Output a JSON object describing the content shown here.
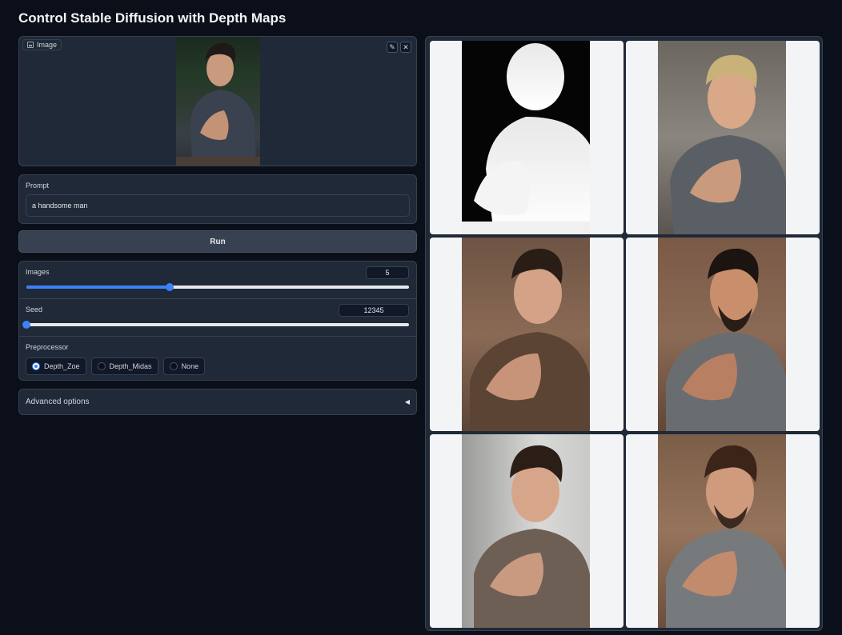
{
  "app": {
    "title": "Control Stable Diffusion with Depth Maps"
  },
  "image_input": {
    "label": "Image",
    "edit_icon": "pencil-icon",
    "close_icon": "close-icon"
  },
  "prompt": {
    "label": "Prompt",
    "value": "a handsome man"
  },
  "run": {
    "label": "Run"
  },
  "images_control": {
    "label": "Images",
    "value": "5",
    "fraction": 0.375
  },
  "seed_control": {
    "label": "Seed",
    "value": "12345",
    "fraction": 0.0
  },
  "preprocessor": {
    "label": "Preprocessor",
    "options": [
      "Depth_Zoe",
      "Depth_Midas",
      "None"
    ],
    "selected": "Depth_Zoe"
  },
  "advanced": {
    "label": "Advanced options",
    "arrow": "◀"
  },
  "colors": {
    "accent": "#3b82f6",
    "background": "#0b0f19",
    "panel": "#1f2937"
  }
}
